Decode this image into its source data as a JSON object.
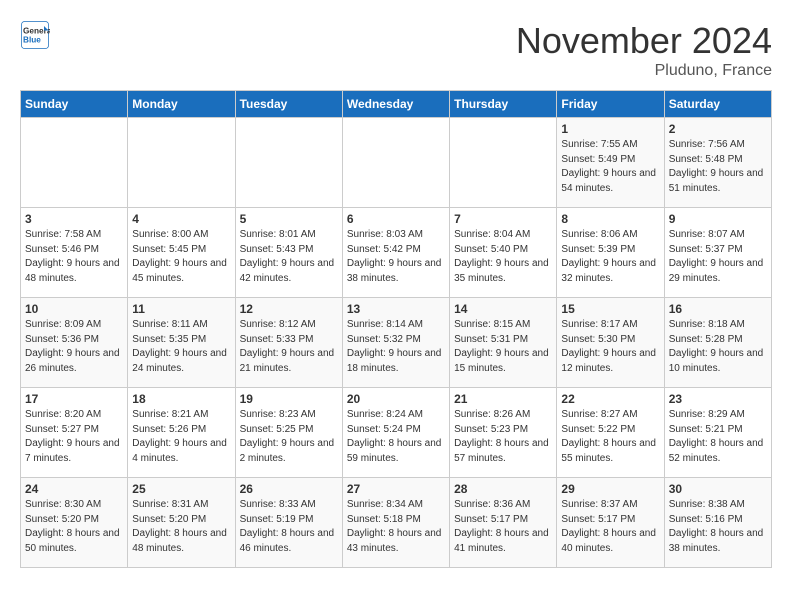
{
  "logo": {
    "general": "General",
    "blue": "Blue"
  },
  "header": {
    "month_year": "November 2024",
    "location": "Pluduno, France"
  },
  "weekdays": [
    "Sunday",
    "Monday",
    "Tuesday",
    "Wednesday",
    "Thursday",
    "Friday",
    "Saturday"
  ],
  "weeks": [
    [
      {
        "day": null
      },
      {
        "day": null
      },
      {
        "day": null
      },
      {
        "day": null
      },
      {
        "day": null
      },
      {
        "day": "1",
        "sunrise": "Sunrise: 7:55 AM",
        "sunset": "Sunset: 5:49 PM",
        "daylight": "Daylight: 9 hours and 54 minutes."
      },
      {
        "day": "2",
        "sunrise": "Sunrise: 7:56 AM",
        "sunset": "Sunset: 5:48 PM",
        "daylight": "Daylight: 9 hours and 51 minutes."
      }
    ],
    [
      {
        "day": "3",
        "sunrise": "Sunrise: 7:58 AM",
        "sunset": "Sunset: 5:46 PM",
        "daylight": "Daylight: 9 hours and 48 minutes."
      },
      {
        "day": "4",
        "sunrise": "Sunrise: 8:00 AM",
        "sunset": "Sunset: 5:45 PM",
        "daylight": "Daylight: 9 hours and 45 minutes."
      },
      {
        "day": "5",
        "sunrise": "Sunrise: 8:01 AM",
        "sunset": "Sunset: 5:43 PM",
        "daylight": "Daylight: 9 hours and 42 minutes."
      },
      {
        "day": "6",
        "sunrise": "Sunrise: 8:03 AM",
        "sunset": "Sunset: 5:42 PM",
        "daylight": "Daylight: 9 hours and 38 minutes."
      },
      {
        "day": "7",
        "sunrise": "Sunrise: 8:04 AM",
        "sunset": "Sunset: 5:40 PM",
        "daylight": "Daylight: 9 hours and 35 minutes."
      },
      {
        "day": "8",
        "sunrise": "Sunrise: 8:06 AM",
        "sunset": "Sunset: 5:39 PM",
        "daylight": "Daylight: 9 hours and 32 minutes."
      },
      {
        "day": "9",
        "sunrise": "Sunrise: 8:07 AM",
        "sunset": "Sunset: 5:37 PM",
        "daylight": "Daylight: 9 hours and 29 minutes."
      }
    ],
    [
      {
        "day": "10",
        "sunrise": "Sunrise: 8:09 AM",
        "sunset": "Sunset: 5:36 PM",
        "daylight": "Daylight: 9 hours and 26 minutes."
      },
      {
        "day": "11",
        "sunrise": "Sunrise: 8:11 AM",
        "sunset": "Sunset: 5:35 PM",
        "daylight": "Daylight: 9 hours and 24 minutes."
      },
      {
        "day": "12",
        "sunrise": "Sunrise: 8:12 AM",
        "sunset": "Sunset: 5:33 PM",
        "daylight": "Daylight: 9 hours and 21 minutes."
      },
      {
        "day": "13",
        "sunrise": "Sunrise: 8:14 AM",
        "sunset": "Sunset: 5:32 PM",
        "daylight": "Daylight: 9 hours and 18 minutes."
      },
      {
        "day": "14",
        "sunrise": "Sunrise: 8:15 AM",
        "sunset": "Sunset: 5:31 PM",
        "daylight": "Daylight: 9 hours and 15 minutes."
      },
      {
        "day": "15",
        "sunrise": "Sunrise: 8:17 AM",
        "sunset": "Sunset: 5:30 PM",
        "daylight": "Daylight: 9 hours and 12 minutes."
      },
      {
        "day": "16",
        "sunrise": "Sunrise: 8:18 AM",
        "sunset": "Sunset: 5:28 PM",
        "daylight": "Daylight: 9 hours and 10 minutes."
      }
    ],
    [
      {
        "day": "17",
        "sunrise": "Sunrise: 8:20 AM",
        "sunset": "Sunset: 5:27 PM",
        "daylight": "Daylight: 9 hours and 7 minutes."
      },
      {
        "day": "18",
        "sunrise": "Sunrise: 8:21 AM",
        "sunset": "Sunset: 5:26 PM",
        "daylight": "Daylight: 9 hours and 4 minutes."
      },
      {
        "day": "19",
        "sunrise": "Sunrise: 8:23 AM",
        "sunset": "Sunset: 5:25 PM",
        "daylight": "Daylight: 9 hours and 2 minutes."
      },
      {
        "day": "20",
        "sunrise": "Sunrise: 8:24 AM",
        "sunset": "Sunset: 5:24 PM",
        "daylight": "Daylight: 8 hours and 59 minutes."
      },
      {
        "day": "21",
        "sunrise": "Sunrise: 8:26 AM",
        "sunset": "Sunset: 5:23 PM",
        "daylight": "Daylight: 8 hours and 57 minutes."
      },
      {
        "day": "22",
        "sunrise": "Sunrise: 8:27 AM",
        "sunset": "Sunset: 5:22 PM",
        "daylight": "Daylight: 8 hours and 55 minutes."
      },
      {
        "day": "23",
        "sunrise": "Sunrise: 8:29 AM",
        "sunset": "Sunset: 5:21 PM",
        "daylight": "Daylight: 8 hours and 52 minutes."
      }
    ],
    [
      {
        "day": "24",
        "sunrise": "Sunrise: 8:30 AM",
        "sunset": "Sunset: 5:20 PM",
        "daylight": "Daylight: 8 hours and 50 minutes."
      },
      {
        "day": "25",
        "sunrise": "Sunrise: 8:31 AM",
        "sunset": "Sunset: 5:20 PM",
        "daylight": "Daylight: 8 hours and 48 minutes."
      },
      {
        "day": "26",
        "sunrise": "Sunrise: 8:33 AM",
        "sunset": "Sunset: 5:19 PM",
        "daylight": "Daylight: 8 hours and 46 minutes."
      },
      {
        "day": "27",
        "sunrise": "Sunrise: 8:34 AM",
        "sunset": "Sunset: 5:18 PM",
        "daylight": "Daylight: 8 hours and 43 minutes."
      },
      {
        "day": "28",
        "sunrise": "Sunrise: 8:36 AM",
        "sunset": "Sunset: 5:17 PM",
        "daylight": "Daylight: 8 hours and 41 minutes."
      },
      {
        "day": "29",
        "sunrise": "Sunrise: 8:37 AM",
        "sunset": "Sunset: 5:17 PM",
        "daylight": "Daylight: 8 hours and 40 minutes."
      },
      {
        "day": "30",
        "sunrise": "Sunrise: 8:38 AM",
        "sunset": "Sunset: 5:16 PM",
        "daylight": "Daylight: 8 hours and 38 minutes."
      }
    ]
  ]
}
